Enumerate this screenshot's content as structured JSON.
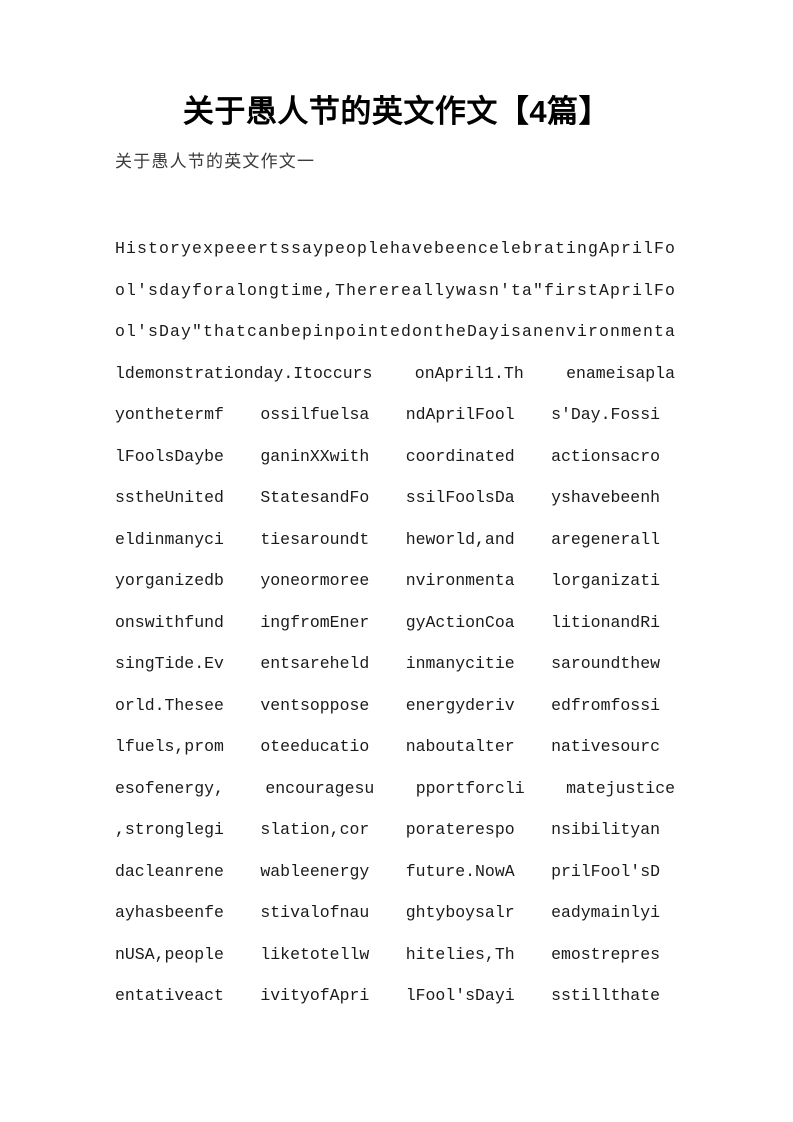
{
  "document": {
    "title": "关于愚人节的英文作文【4篇】",
    "subtitle": "关于愚人节的英文作文一"
  },
  "body": {
    "lines": [
      {
        "id": "line-1",
        "layout": "solid",
        "text": "HistoryexpeeertssaypeoplehavebeencelebratingAprilFo"
      },
      {
        "id": "line-2",
        "layout": "solid",
        "text": "ol'sdayforalongtime,Therereallywasn'ta\"firstAprilFo"
      },
      {
        "id": "line-3",
        "layout": "solid",
        "text": "ol'sDay\"thatcanbepinpointedontheDayisanenvironmenta"
      },
      {
        "id": "line-4",
        "layout": "cols",
        "wide": true,
        "segments": [
          "ldemonstrationday.Itoccurs",
          "onApril1.Th",
          "enameisapla"
        ]
      },
      {
        "id": "line-5",
        "layout": "cols",
        "segments": [
          "yonthetermf",
          "ossilfuelsa",
          "ndAprilFool",
          "s'Day.Fossi"
        ]
      },
      {
        "id": "line-6",
        "layout": "cols",
        "segments": [
          "lFoolsDaybe",
          "ganinXXwith",
          "coordinated",
          "actionsacro"
        ]
      },
      {
        "id": "line-7",
        "layout": "cols",
        "segments": [
          "sstheUnited",
          "StatesandFo",
          "ssilFoolsDa",
          "yshavebeenh"
        ]
      },
      {
        "id": "line-8",
        "layout": "cols",
        "segments": [
          "eldinmanyci",
          "tiesaroundt",
          "heworld,and",
          "aregenerall"
        ]
      },
      {
        "id": "line-9",
        "layout": "cols",
        "segments": [
          "yorganizedb",
          "yoneormoree",
          "nvironmenta",
          "lorganizati"
        ]
      },
      {
        "id": "line-10",
        "layout": "cols",
        "segments": [
          "onswithfund",
          "ingfromEner",
          "gyActionCoa",
          "litionandRi"
        ]
      },
      {
        "id": "line-11",
        "layout": "cols",
        "segments": [
          "singTide.Ev",
          "entsareheld",
          "inmanycitie",
          "saroundthew"
        ]
      },
      {
        "id": "line-12",
        "layout": "cols",
        "segments": [
          "orld.Thesee",
          "ventsoppose",
          "energyderiv",
          "edfromfossi"
        ]
      },
      {
        "id": "line-13",
        "layout": "cols",
        "segments": [
          "lfuels,prom",
          "oteeducatio",
          "naboutalter",
          "nativesourc"
        ]
      },
      {
        "id": "line-14",
        "layout": "cols",
        "wide": true,
        "segments": [
          "esofenergy,",
          "encouragesu",
          "pportforcli",
          "matejustice"
        ]
      },
      {
        "id": "line-15",
        "layout": "cols",
        "segments": [
          ",stronglegi",
          "slation,cor",
          "poraterespo",
          "nsibilityan"
        ]
      },
      {
        "id": "line-16",
        "layout": "cols",
        "segments": [
          "dacleanrene",
          "wableenergy",
          "future.NowA",
          "prilFool'sD"
        ]
      },
      {
        "id": "line-17",
        "layout": "cols",
        "segments": [
          "ayhasbeenfe",
          "stivalofnau",
          "ghtyboysalr",
          "eadymainlyi"
        ]
      },
      {
        "id": "line-18",
        "layout": "cols",
        "segments": [
          "nUSA,people",
          "liketotellw",
          "hitelies,Th",
          "emostrepres"
        ]
      },
      {
        "id": "line-19",
        "layout": "cols",
        "segments": [
          "entativeact",
          "ivityofApri",
          "lFool'sDayi",
          "sstillthate"
        ]
      }
    ]
  },
  "colors": {
    "page_background": "#ffffff",
    "title_text": "#000000",
    "subtitle_text": "#3a3a3a",
    "body_text": "#1a1a1a"
  }
}
